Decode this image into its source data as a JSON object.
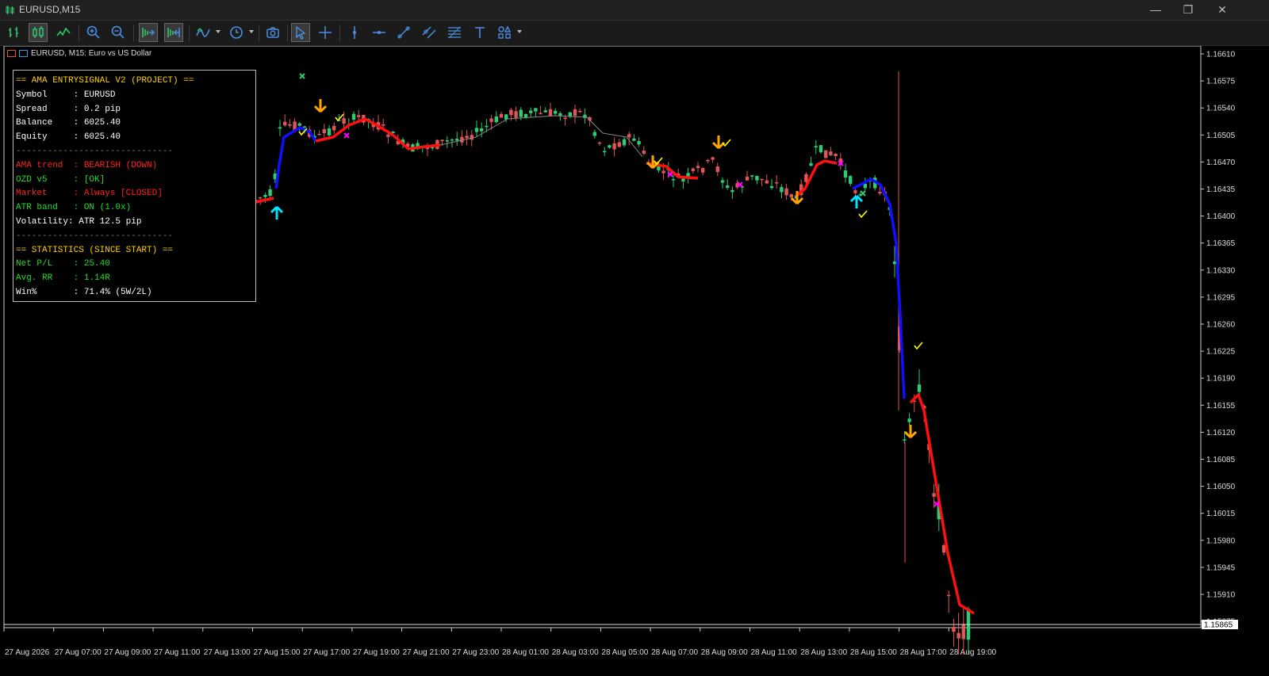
{
  "window": {
    "title": "EURUSD,M15"
  },
  "toolbar": {
    "icons": [
      "bar-chart-icon",
      "candlestick-icon",
      "line-chart-icon",
      "zoom-in-icon",
      "zoom-out-icon",
      "autoscroll-icon",
      "chart-shift-icon",
      "indicators-icon",
      "periods-icon",
      "screenshot-icon",
      "cursor-icon",
      "crosshair-icon",
      "vertical-line-icon",
      "horizontal-line-icon",
      "trendline-icon",
      "equidistant-channel-icon",
      "fibonacci-icon",
      "text-icon",
      "shapes-icon"
    ]
  },
  "chart": {
    "header": "EURUSD, M15:  Euro vs US Dollar",
    "current_price": "1.15865",
    "price_labels": [
      "1.16610",
      "1.16575",
      "1.16540",
      "1.16505",
      "1.16470",
      "1.16435",
      "1.16400",
      "1.16365",
      "1.16330",
      "1.16295",
      "1.16260",
      "1.16225",
      "1.16190",
      "1.16155",
      "1.16120",
      "1.16085",
      "1.16050",
      "1.16015",
      "1.15980",
      "1.15945",
      "1.15910",
      "1.15875"
    ],
    "time_labels": [
      "27 Aug 2026",
      "27 Aug 07:00",
      "27 Aug 09:00",
      "27 Aug 11:00",
      "27 Aug 13:00",
      "27 Aug 15:00",
      "27 Aug 17:00",
      "27 Aug 19:00",
      "27 Aug 21:00",
      "27 Aug 23:00",
      "28 Aug 01:00",
      "28 Aug 03:00",
      "28 Aug 05:00",
      "28 Aug 07:00",
      "28 Aug 09:00",
      "28 Aug 11:00",
      "28 Aug 13:00",
      "28 Aug 15:00",
      "28 Aug 17:00",
      "28 Aug 19:00"
    ],
    "colors": {
      "bull": "#2ecc71",
      "bear": "#e05555",
      "ama_up": "#1010ff",
      "ama_down": "#ff1010",
      "buy_arrow": "#00e5ff",
      "sell_arrow": "#ffa500",
      "check": "#ffff00",
      "exit_x": "#ff00ff"
    }
  },
  "panel": {
    "rows": [
      {
        "text": "== AMA ENTRYSIGNAL V2 (PROJECT) ==",
        "color": "yellow"
      },
      {
        "text": "Symbol     : EURUSD",
        "color": "white"
      },
      {
        "text": "Spread     : 0.2 pip",
        "color": "white"
      },
      {
        "text": "Balance    : 6025.40",
        "color": "white"
      },
      {
        "text": "Equity     : 6025.40",
        "color": "white"
      },
      {
        "text": "------------------------------",
        "color": "gray"
      },
      {
        "text": "AMA trend  : BEARISH (DOWN)",
        "color": "red"
      },
      {
        "text": "OZD v5     : [OK]",
        "color": "green"
      },
      {
        "text": "Market     : Always [CLOSED]",
        "color": "red"
      },
      {
        "text": "ATR band   : ON (1.0x)",
        "color": "green"
      },
      {
        "text": "Volatility: ATR 12.5 pip",
        "color": "white"
      },
      {
        "text": "------------------------------",
        "color": "gray"
      },
      {
        "text": "== STATISTICS (SINCE START) ==",
        "color": "yellow"
      },
      {
        "text": "Net P/L    : 25.40",
        "color": "green"
      },
      {
        "text": "Avg. RR    : 1.14R",
        "color": "green"
      },
      {
        "text": "Win%       : 71.4% (5W/2L)",
        "color": "white"
      }
    ]
  }
}
